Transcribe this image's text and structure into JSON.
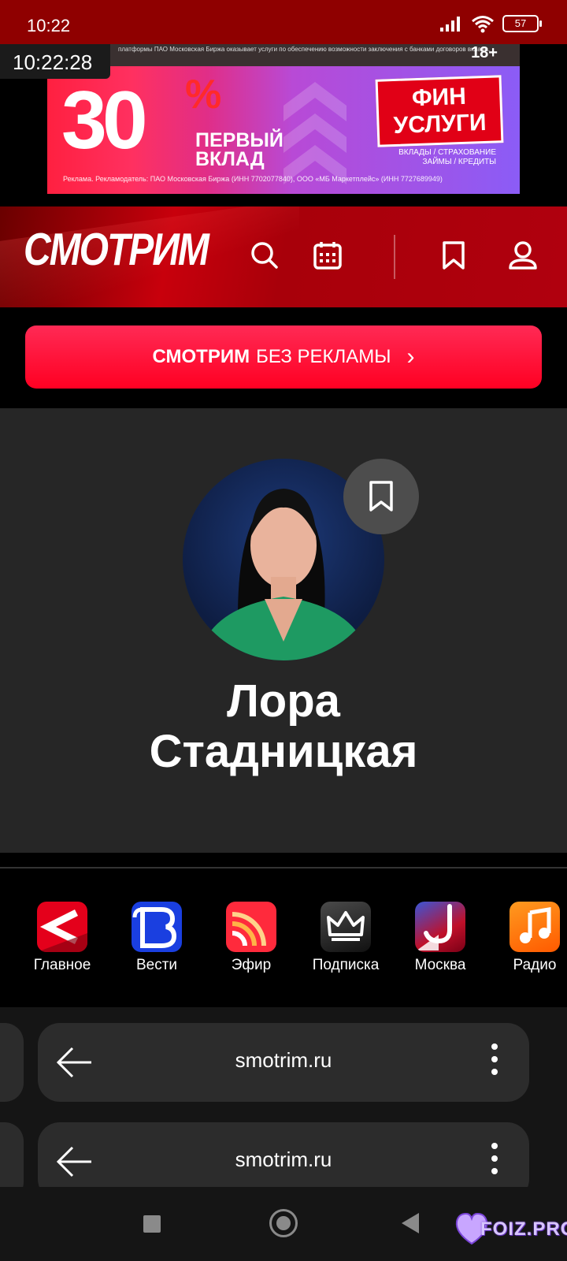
{
  "status_bar": {
    "time": "10:22",
    "battery": "57"
  },
  "overlay_clock": "10:22:28",
  "ad": {
    "top_strip": "платформы ПАО Московская Биржа оказывает услуги по обеспечению возможности заключения с банками договоров вклада.",
    "age_rating": "18+",
    "big_number": "30",
    "percent": "%",
    "line1": "ПЕРВЫЙ",
    "line2": "ВКЛАД",
    "badge_line1": "ФИН",
    "badge_line2": "УСЛУГИ",
    "small_line1": "ВКЛАДЫ / СТРАХОВАНИЕ",
    "small_line2": "ЗАЙМЫ / КРЕДИТЫ",
    "legal": "Реклама. Рекламодатель: ПАО Московская Биржа (ИНН 7702077840), ООО «МБ Маркетплейс» (ИНН 7727689949)"
  },
  "header": {
    "logo": "СМОТРИМ",
    "icons": [
      "search-icon",
      "calendar-icon",
      "bookmark-icon",
      "user-icon"
    ]
  },
  "cta": {
    "bold": "СМОТРИМ",
    "rest": "БЕЗ РЕКЛАМЫ",
    "chevron": "›"
  },
  "profile": {
    "name_line1": "Лора",
    "name_line2": "Стадницкая"
  },
  "apps": [
    {
      "label": "Главное"
    },
    {
      "label": "Вести"
    },
    {
      "label": "Эфир"
    },
    {
      "label": "Подписка"
    },
    {
      "label": "Москва"
    },
    {
      "label": "Радио"
    }
  ],
  "recents": [
    {
      "url": "smotrim.ru"
    },
    {
      "url": "smotrim.ru"
    }
  ],
  "watermark": "FOIZ.PRO",
  "colors": {
    "brand_red": "#c8000c",
    "cta_red": "#ff1a3c",
    "profile_bg": "#262626"
  }
}
